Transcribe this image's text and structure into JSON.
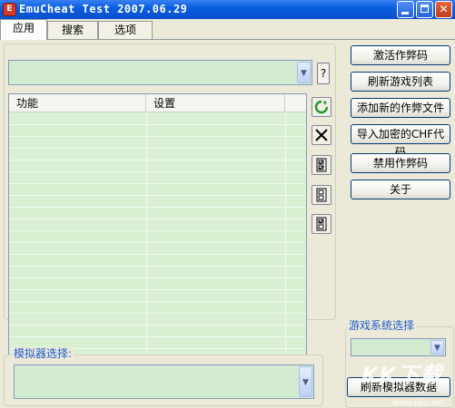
{
  "window": {
    "title": "EmuCheat Test 2007.06.29",
    "icon_text": "E",
    "controls": {
      "minimize": "minimize-icon",
      "maximize": "maximize-icon",
      "close_symbol": "✕"
    }
  },
  "tabs": [
    {
      "label": "应用",
      "active": true
    },
    {
      "label": "搜索",
      "active": false
    },
    {
      "label": "选项",
      "active": false
    }
  ],
  "top_combo": {
    "value": "",
    "arrow": "▼"
  },
  "help_button": {
    "label": "?"
  },
  "cheat_list": {
    "columns": [
      "功能",
      "设置",
      ""
    ],
    "rows": []
  },
  "side_icons": [
    "refresh-icon",
    "delete-icon",
    "check-all-icon",
    "uncheck-all-icon",
    "toggle-check-icon"
  ],
  "actions": {
    "activate": "激活作弊码",
    "refresh_games": "刷新游戏列表",
    "add_cheat_file": "添加新的作弊文件",
    "import_chf": "导入加密的CHF代码",
    "disable": "禁用作弊码",
    "about": "关于"
  },
  "game_system": {
    "label": "游戏系统选择",
    "value": "",
    "arrow": "▼",
    "refresh_emu": "刷新模拟器数据"
  },
  "emulator": {
    "label": "模拟器选择:",
    "value": "",
    "arrow": "▼"
  },
  "watermark": {
    "text": "KK下载",
    "url": "www.kkx.net"
  },
  "colors": {
    "titlebar": "#0b4fce",
    "list_bg": "#d9f0d3",
    "window_bg": "#ece9d8",
    "group_label": "#1d5cce"
  }
}
